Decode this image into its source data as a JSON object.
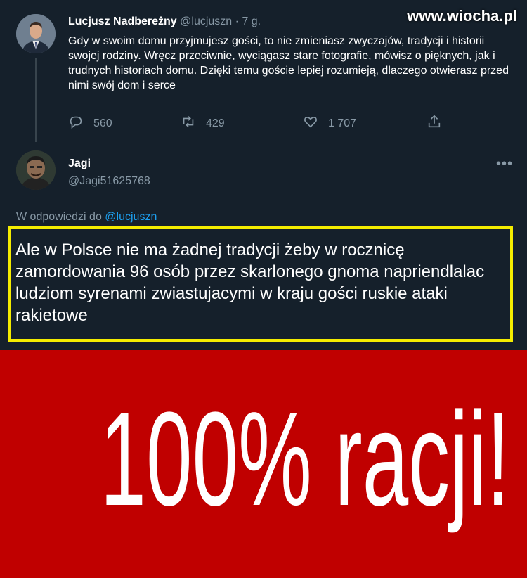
{
  "watermark": "www.wiocha.pl",
  "tweet1": {
    "name": "Lucjusz Nadbereżny",
    "handle": "@lucjuszn",
    "separator": "·",
    "time": "7 g.",
    "body": "Gdy w swoim domu przyjmujesz gości, to nie zmieniasz zwyczajów, tradycji i historii swojej rodziny. Wręcz przeciwnie, wyciągasz stare fotografie, mówisz o pięknych, jak i trudnych historiach domu. Dzięki temu goście lepiej rozumieją, dlaczego otwierasz przed nimi swój dom i serce",
    "actions": {
      "reply_icon": "reply-icon",
      "reply_count": "560",
      "retweet_icon": "retweet-icon",
      "retweet_count": "429",
      "like_icon": "heart-icon",
      "like_count": "1 707",
      "share_icon": "share-icon"
    }
  },
  "tweet2": {
    "name": "Jagi",
    "handle": "@Jagi51625768",
    "more_icon": "more-icon",
    "more_label": "•••",
    "reply_prefix": "W odpowiedzi do",
    "reply_mention": "@lucjuszn",
    "body": "Ale w Polsce nie ma żadnej tradycji żeby w rocznicę zamordowania 96 osób przez skarlonego gnoma napriendlalac ludziom syrenami zwiastujacymi w kraju gości ruskie ataki rakietowe",
    "highlight_color": "#f4ec00"
  },
  "banner": {
    "text": "100% racji!",
    "background": "#c00000"
  },
  "colors": {
    "background": "#15202b",
    "secondary_text": "#8899a6",
    "link": "#1da1f2"
  }
}
